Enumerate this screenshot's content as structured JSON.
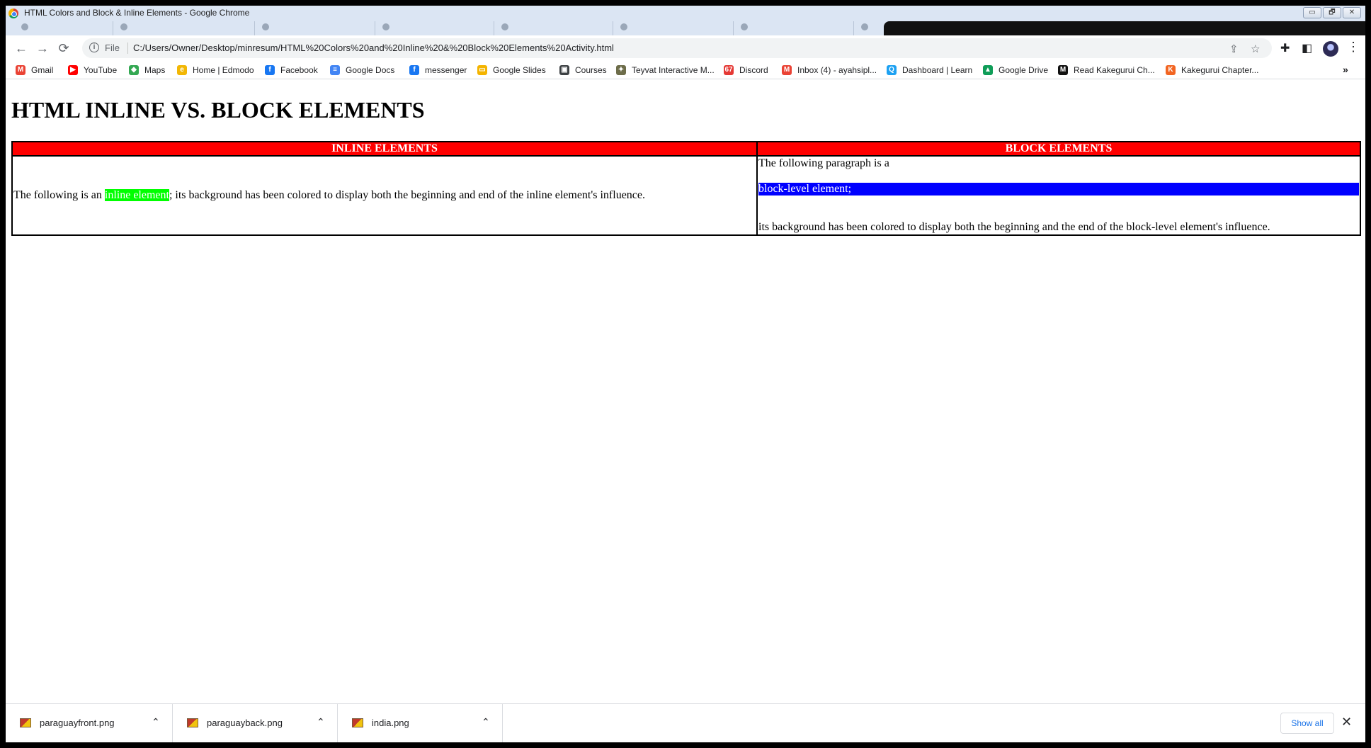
{
  "window": {
    "title": "HTML Colors and Block & Inline Elements - Google Chrome",
    "controls": {
      "minimize": "▭",
      "restore": "🗗",
      "close": "✕"
    }
  },
  "toolbar": {
    "back": "←",
    "forward": "→",
    "reload": "⟳",
    "file_label": "File",
    "url": "C:/Users/Owner/Desktop/minresum/HTML%20Colors%20and%20Inline%20&%20Block%20Elements%20Activity.html",
    "menu": "⋮"
  },
  "bookmarks": {
    "items": [
      {
        "label": "Gmail",
        "icon": "gmail-icon",
        "color": "#ea4335",
        "glyph": "M"
      },
      {
        "label": "YouTube",
        "icon": "youtube-icon",
        "color": "#ff0000",
        "glyph": "▶"
      },
      {
        "label": "Maps",
        "icon": "maps-icon",
        "color": "#34a853",
        "glyph": "◆"
      },
      {
        "label": "Home | Edmodo",
        "icon": "edmodo-icon",
        "color": "#f2b705",
        "glyph": "e"
      },
      {
        "label": "Facebook",
        "icon": "facebook-icon",
        "color": "#1877f2",
        "glyph": "f"
      },
      {
        "label": "Google Docs",
        "icon": "docs-icon",
        "color": "#4285f4",
        "glyph": "≡"
      },
      {
        "label": "messenger",
        "icon": "facebook-icon",
        "color": "#1877f2",
        "glyph": "f"
      },
      {
        "label": "Google Slides",
        "icon": "slides-icon",
        "color": "#f4b400",
        "glyph": "▭"
      },
      {
        "label": "Courses",
        "icon": "courses-icon",
        "color": "#3c4043",
        "glyph": "▣"
      },
      {
        "label": "Teyvat Interactive M...",
        "icon": "teyvat-icon",
        "color": "#6d6d4a",
        "glyph": "✦"
      },
      {
        "label": "Discord",
        "icon": "discord-icon",
        "color": "#e53935",
        "glyph": "67"
      },
      {
        "label": "Inbox (4) - ayahsipl...",
        "icon": "gmail-icon",
        "color": "#ea4335",
        "glyph": "M"
      },
      {
        "label": "Dashboard | Learn",
        "icon": "learn-icon",
        "color": "#1da1f2",
        "glyph": "Q"
      },
      {
        "label": "Google Drive",
        "icon": "drive-icon",
        "color": "#0f9d58",
        "glyph": "▲"
      },
      {
        "label": "Read Kakegurui Ch...",
        "icon": "manga-icon",
        "color": "#111111",
        "glyph": "M"
      },
      {
        "label": "Kakegurui Chapter...",
        "icon": "manga-icon",
        "color": "#f26522",
        "glyph": "K"
      }
    ],
    "more": "»"
  },
  "page": {
    "heading": "HTML INLINE VS. BLOCK ELEMENTS",
    "table": {
      "headers": [
        "INLINE ELEMENTS",
        "BLOCK ELEMENTS"
      ],
      "inline_cell": {
        "before": "The following is an ",
        "highlight": "inline element",
        "after": "; its background has been colored to display both the beginning and end of the inline element's influence."
      },
      "block_cell": {
        "intro": "The following paragraph is a",
        "highlight": "block-level element;",
        "outro": "its background has been colored to display both the beginning and the end of the block-level element's influence."
      }
    },
    "colors": {
      "header_bg": "#ff0000",
      "inline_bg": "#00ff00",
      "block_bg": "#0000ff"
    }
  },
  "downloads": {
    "items": [
      {
        "name": "paraguayfront.png"
      },
      {
        "name": "paraguayback.png"
      },
      {
        "name": "india.png"
      }
    ],
    "show_all": "Show all",
    "close": "✕"
  }
}
